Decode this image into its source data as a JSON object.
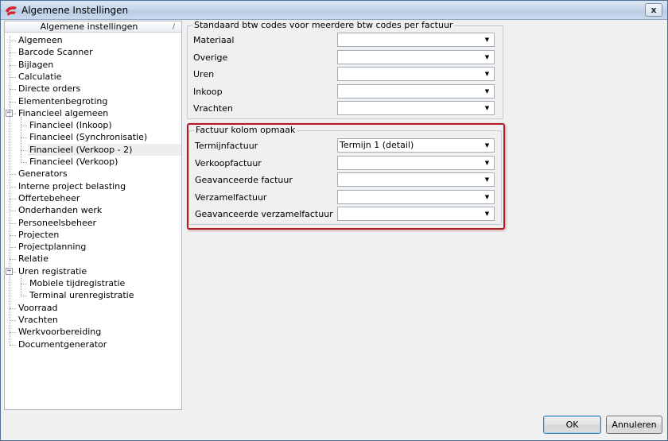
{
  "window": {
    "title": "Algemene Instellingen",
    "close_glyph": "x",
    "accent": "#d4212b"
  },
  "tree": {
    "header": "Algemene instellingen",
    "sort_glyph": "/",
    "items": [
      {
        "label": "Algemeen",
        "level": 0
      },
      {
        "label": "Barcode Scanner",
        "level": 0
      },
      {
        "label": "Bijlagen",
        "level": 0
      },
      {
        "label": "Calculatie",
        "level": 0
      },
      {
        "label": "Directe orders",
        "level": 0
      },
      {
        "label": "Elementenbegroting",
        "level": 0
      },
      {
        "label": "Financieel algemeen",
        "level": 0,
        "expander": "−"
      },
      {
        "label": "Financieel (Inkoop)",
        "level": 1
      },
      {
        "label": "Financieel (Synchronisatie)",
        "level": 1
      },
      {
        "label": "Financieel (Verkoop - 2)",
        "level": 1,
        "selected": true
      },
      {
        "label": "Financieel (Verkoop)",
        "level": 1
      },
      {
        "label": "Generators",
        "level": 0
      },
      {
        "label": "Interne project belasting",
        "level": 0
      },
      {
        "label": "Offertebeheer",
        "level": 0
      },
      {
        "label": "Onderhanden werk",
        "level": 0
      },
      {
        "label": "Personeelsbeheer",
        "level": 0
      },
      {
        "label": "Projecten",
        "level": 0
      },
      {
        "label": "Projectplanning",
        "level": 0
      },
      {
        "label": "Relatie",
        "level": 0
      },
      {
        "label": "Uren registratie",
        "level": 0,
        "expander": "−"
      },
      {
        "label": "Mobiele tijdregistratie",
        "level": 1
      },
      {
        "label": "Terminal urenregistratie",
        "level": 1
      },
      {
        "label": "Voorraad",
        "level": 0
      },
      {
        "label": "Vrachten",
        "level": 0
      },
      {
        "label": "Werkvoorbereiding",
        "level": 0
      },
      {
        "label": "Documentgenerator",
        "level": 0
      }
    ]
  },
  "btw_group": {
    "title": "Standaard btw codes voor meerdere btw codes per factuur",
    "fields": [
      {
        "label": "Materiaal",
        "value": ""
      },
      {
        "label": "Overige",
        "value": ""
      },
      {
        "label": "Uren",
        "value": ""
      },
      {
        "label": "Inkoop",
        "value": ""
      },
      {
        "label": "Vrachten",
        "value": ""
      }
    ]
  },
  "factuur_group": {
    "title": "Factuur kolom opmaak",
    "fields": [
      {
        "label": "Termijnfactuur",
        "value": "Termijn 1 (detail)"
      },
      {
        "label": "Verkoopfactuur",
        "value": ""
      },
      {
        "label": "Geavanceerde factuur",
        "value": ""
      },
      {
        "label": "Verzamelfactuur",
        "value": ""
      },
      {
        "label": "Geavanceerde verzamelfactuur",
        "value": ""
      }
    ]
  },
  "icons": {
    "dropdown_arrow": "▼",
    "app_icon": "red-swoosh-icon"
  },
  "buttons": {
    "ok": "OK",
    "cancel": "Annuleren"
  }
}
